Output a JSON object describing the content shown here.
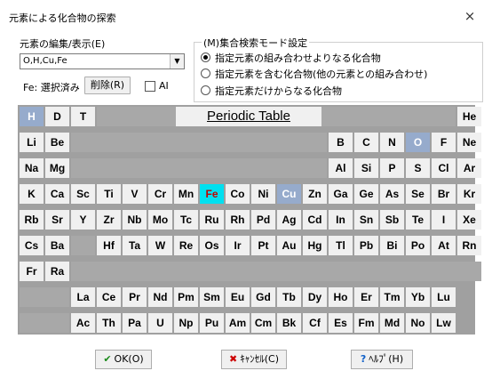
{
  "window": {
    "title": "元素による化合物の探索",
    "close_label": "×"
  },
  "element_edit": {
    "label": "元素の編集/表示(E)",
    "combo_value": "O,H,Cu,Fe",
    "selected_label": "Fe: 選択済み",
    "delete_button": "削除(R)",
    "ai_checkbox_label": "AI",
    "ai_checked": false
  },
  "search_mode": {
    "title": "(M)集合検索モード設定",
    "options": [
      {
        "label": "指定元素の組み合わせよりなる化合物",
        "selected": true
      },
      {
        "label": "指定元素を含む化合物(他の元素との組み合わせ)",
        "selected": false
      },
      {
        "label": "指定元素だけからなる化合物",
        "selected": false
      }
    ]
  },
  "periodic_table": {
    "title": "Periodic Table",
    "rows": [
      [
        "H",
        "D",
        "T",
        "",
        "",
        "",
        "",
        "",
        "",
        "",
        "",
        "",
        "",
        "",
        "",
        "",
        "",
        "He"
      ],
      [
        "Li",
        "Be",
        "",
        "",
        "",
        "",
        "",
        "",
        "",
        "",
        "",
        "",
        "B",
        "C",
        "N",
        "O",
        "F",
        "Ne"
      ],
      [
        "Na",
        "Mg",
        "",
        "",
        "",
        "",
        "",
        "",
        "",
        "",
        "",
        "",
        "Al",
        "Si",
        "P",
        "S",
        "Cl",
        "Ar"
      ],
      [
        "K",
        "Ca",
        "Sc",
        "Ti",
        "V",
        "Cr",
        "Mn",
        "Fe",
        "Co",
        "Ni",
        "Cu",
        "Zn",
        "Ga",
        "Ge",
        "As",
        "Se",
        "Br",
        "Kr"
      ],
      [
        "Rb",
        "Sr",
        "Y",
        "Zr",
        "Nb",
        "Mo",
        "Tc",
        "Ru",
        "Rh",
        "Pd",
        "Ag",
        "Cd",
        "In",
        "Sn",
        "Sb",
        "Te",
        "I",
        "Xe"
      ],
      [
        "Cs",
        "Ba",
        "",
        "Hf",
        "Ta",
        "W",
        "Re",
        "Os",
        "Ir",
        "Pt",
        "Au",
        "Hg",
        "Tl",
        "Pb",
        "Bi",
        "Po",
        "At",
        "Rn"
      ],
      [
        "Fr",
        "Ra",
        "",
        "",
        "",
        "",
        "",
        "",
        "",
        "",
        "",
        "",
        "",
        "",
        "",
        "",
        "",
        ""
      ],
      [
        "",
        "",
        "La",
        "Ce",
        "Pr",
        "Nd",
        "Pm",
        "Sm",
        "Eu",
        "Gd",
        "Tb",
        "Dy",
        "Ho",
        "Er",
        "Tm",
        "Yb",
        "Lu",
        ""
      ],
      [
        "",
        "",
        "Ac",
        "Th",
        "Pa",
        "U",
        "Np",
        "Pu",
        "Am",
        "Cm",
        "Bk",
        "Cf",
        "Es",
        "Fm",
        "Md",
        "No",
        "Lw",
        ""
      ]
    ],
    "selected_current": [
      "Fe"
    ],
    "selected_previous": [
      "H",
      "O",
      "Cu"
    ],
    "colors": {
      "current": "#00e0f0",
      "current_text": "#c00000",
      "previous": "#96abcc",
      "previous_text": "#ffffff"
    }
  },
  "buttons": {
    "ok": "OK(O)",
    "cancel": "ｷｬﾝｾﾙ(C)",
    "help": "ﾍﾙﾌﾟ(H)"
  },
  "icons": {
    "ok": "checkmark-icon",
    "cancel": "x-icon",
    "help": "question-icon"
  }
}
